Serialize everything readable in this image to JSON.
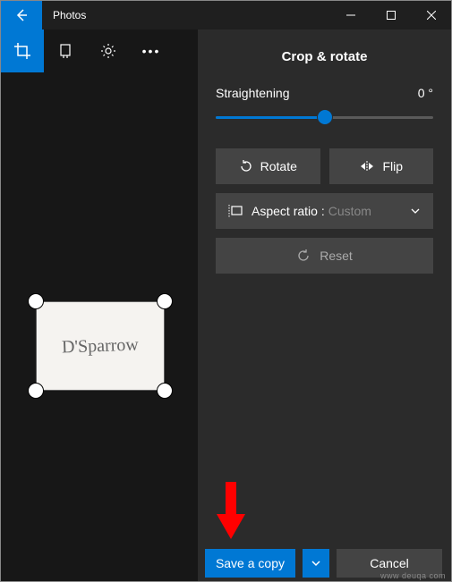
{
  "titlebar": {
    "app_name": "Photos"
  },
  "panel": {
    "title": "Crop & rotate",
    "straighten_label": "Straightening",
    "straighten_value": "0 °",
    "rotate_label": "Rotate",
    "flip_label": "Flip",
    "aspect_label": "Aspect ratio :",
    "aspect_value": "Custom",
    "reset_label": "Reset"
  },
  "footer": {
    "save_label": "Save a copy",
    "cancel_label": "Cancel"
  },
  "canvas": {
    "signature_text": "D'Sparrow"
  },
  "watermark": "www deuqa com"
}
